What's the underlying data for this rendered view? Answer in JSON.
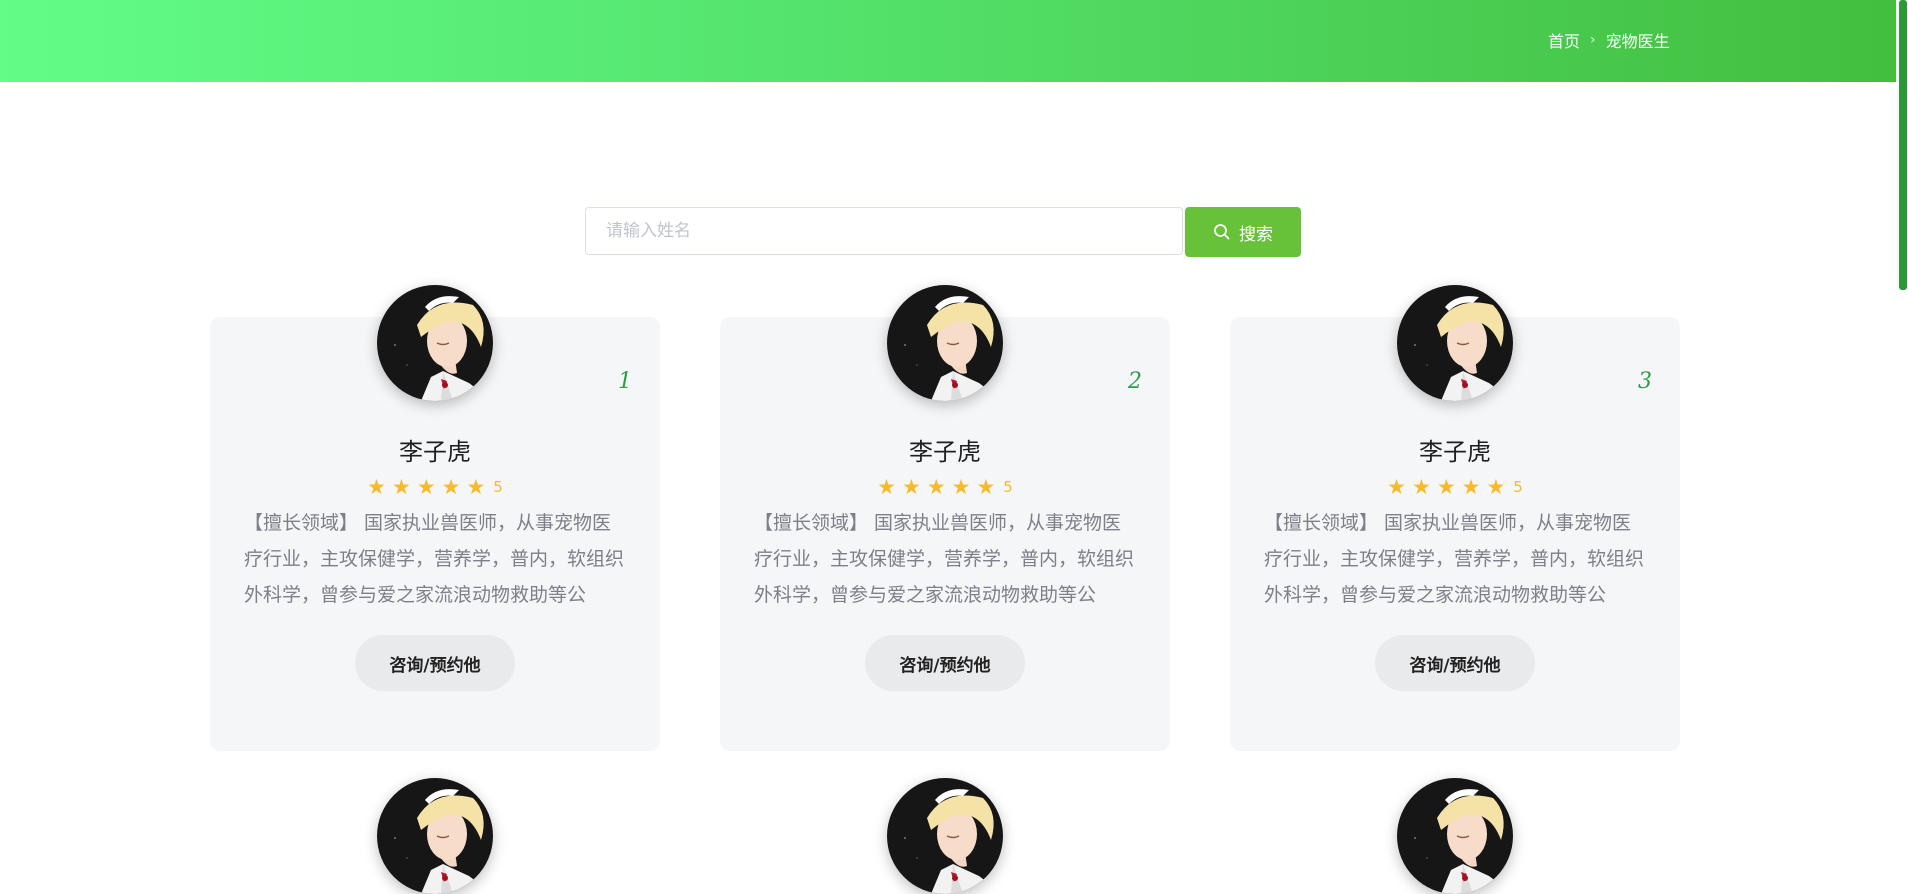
{
  "header": {
    "breadcrumb": [
      {
        "label": "首页"
      },
      {
        "label": "宠物医生"
      }
    ]
  },
  "search": {
    "placeholder": "请输入姓名",
    "button_label": "搜索"
  },
  "doctors": [
    {
      "rank": "1",
      "name": "李子虎",
      "rating": "5",
      "description": "【擅长领域】 国家执业兽医师，从事宠物医疗行业，主攻保健学，营养学，普内，软组织外科学，曾参与爱之家流浪动物救助等公",
      "cta_label": "咨询/预约他"
    },
    {
      "rank": "2",
      "name": "李子虎",
      "rating": "5",
      "description": "【擅长领域】 国家执业兽医师，从事宠物医疗行业，主攻保健学，营养学，普内，软组织外科学，曾参与爱之家流浪动物救助等公",
      "cta_label": "咨询/预约他"
    },
    {
      "rank": "3",
      "name": "李子虎",
      "rating": "5",
      "description": "【擅长领域】 国家执业兽医师，从事宠物医疗行业，主攻保健学，营养学，普内，软组织外科学，曾参与爱之家流浪动物救助等公",
      "cta_label": "咨询/预约他"
    }
  ],
  "colors": {
    "header_gradient_start": "#61fd87",
    "header_gradient_end": "#43be3f",
    "search_button": "#67c23a",
    "star": "#f7ba2a",
    "rank": "#2f9d48",
    "card_bg": "#f5f6f8"
  }
}
